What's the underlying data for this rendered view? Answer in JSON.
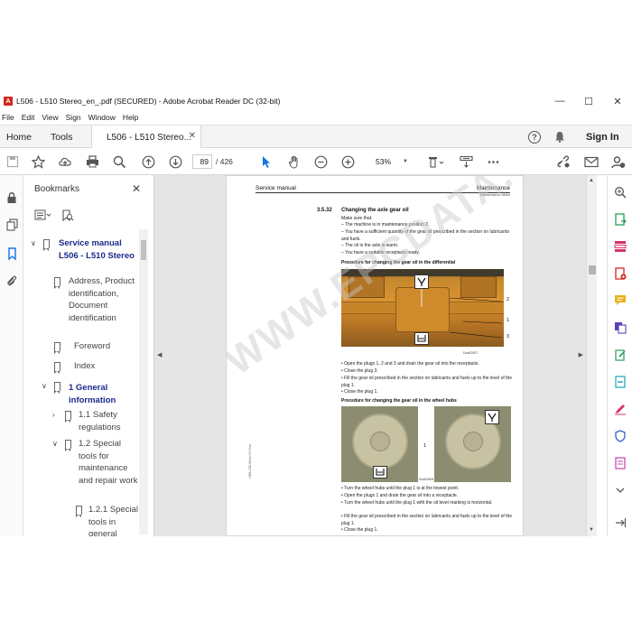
{
  "window": {
    "title": "L506 - L510 Stereo_en_.pdf (SECURED) - Adobe Acrobat Reader DC (32-bit)",
    "app_icon_label": "A",
    "controls": {
      "minimize": "—",
      "maximize": "☐",
      "close": "✕"
    }
  },
  "menu": [
    "File",
    "Edit",
    "View",
    "Sign",
    "Window",
    "Help"
  ],
  "tabs": {
    "home": "Home",
    "tools": "Tools",
    "document": "L506 - L510 Stereo...",
    "close": "✕",
    "help": "?",
    "sign_in": "Sign In"
  },
  "toolbar": {
    "page_current": "89",
    "page_total": "/ 426",
    "zoom": "53%",
    "icons": [
      "save-icon",
      "star-icon",
      "upload-icon",
      "print-icon",
      "find-icon",
      "prev-page-icon",
      "next-page-icon",
      "select-cursor-icon",
      "hand-icon",
      "zoom-out-icon",
      "zoom-in-icon",
      "zoom-dropdown",
      "page-view-icon",
      "scroll-icon",
      "more-icon",
      "share-link-icon",
      "email-icon",
      "user-icon"
    ]
  },
  "bookmarks": {
    "header": "Bookmarks",
    "close": "✕",
    "items": [
      {
        "label": "Service manual L506 - L510 Stereo",
        "level": 0,
        "expanded": true,
        "bold": true
      },
      {
        "label": "Address, Product identification, Document identification",
        "level": 1,
        "bold": false
      },
      {
        "label": "Foreword",
        "level": 1,
        "bold": false
      },
      {
        "label": "Index",
        "level": 1,
        "bold": false
      },
      {
        "label": "1 General information",
        "level": 1,
        "expanded": true,
        "bold": true
      },
      {
        "label": "1.1 Safety regulations",
        "level": 2,
        "collapsed": true,
        "bold": false
      },
      {
        "label": "1.2 Special tools for maintenance and repair work",
        "level": 2,
        "expanded": true,
        "bold": false
      },
      {
        "label": "1.2.1 Special tools in general",
        "level": 3,
        "bold": false
      }
    ]
  },
  "page": {
    "header_left": "Service manual",
    "header_right": "Maintenance",
    "header_sub": "Maintenance tasks",
    "section_number": "3.5.32",
    "section_title": "Changing the axle gear oil",
    "intro": "Make sure that:",
    "conditions": [
      "– The machine is in maintenance position 2.",
      "– You have a sufficient quantity of the gear oil prescribed in the section on lubricants and fuels.",
      "– The oil in the axle is warm.",
      "– You have a suitable receptacle ready."
    ],
    "proc1_title": "Procedure for changing the gear oil in the differential",
    "photo1_labels": [
      "2",
      "1",
      "3"
    ],
    "photo1_caption": "Doa03907",
    "proc1_steps": [
      "• Open the plugs 1, 2 and 3 and drain the gear oil into the receptacle.",
      "• Close the plug 3.",
      "• Fill the gear oil prescribed in the section on lubricants and fuels up to the level of the plug 1.",
      "• Close the plug 1."
    ],
    "proc2_title": "Procedure for changing the gear oil in the wheel hubs",
    "photo2_label": "1",
    "photo2_caption": "Doa03908",
    "proc2_steps": [
      "• Turn the wheel hubs until the plug 1 is at the lowest point.",
      "• Open the plugs 1 and drain the gear oil into a receptacle.",
      "• Turn the wheel hubs until the plug 1 with the oil level marking is horizontal.",
      "• Fill the gear oil prescribed in the section on lubricants and fuels up to the level of the plug 1.",
      "• Close the plug 1."
    ],
    "side_note": "L506-L510 Stereo 3.5.3 en",
    "watermark": "WWW.EPCDATA.COM"
  },
  "colors": {
    "bookmark_bold": "#1a2a8c",
    "accent_tool": "#1473e6",
    "photo_orange": "#d9922f"
  }
}
